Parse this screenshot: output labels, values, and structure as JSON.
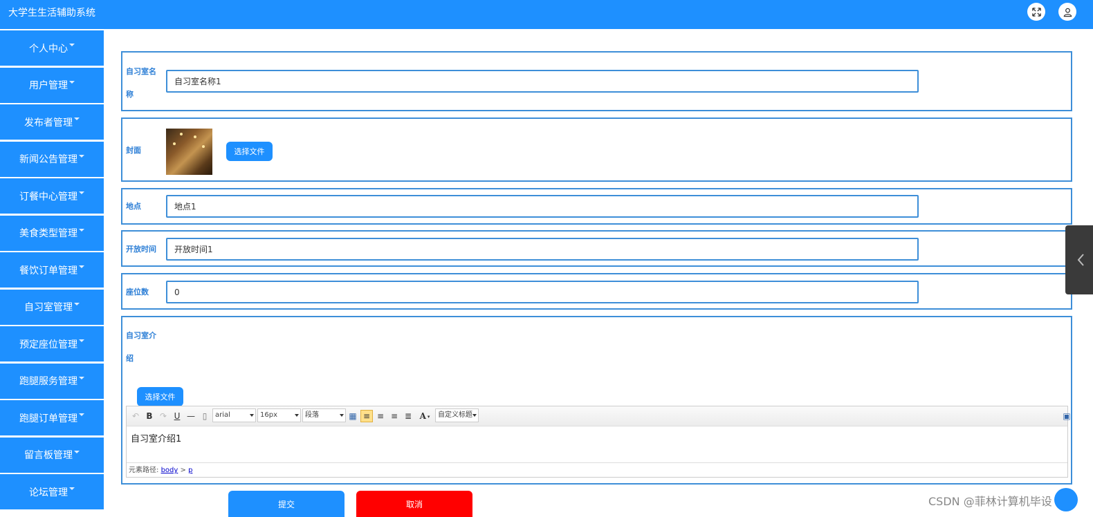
{
  "app": {
    "title": "大学生生活辅助系统"
  },
  "header": {
    "icons": [
      "fullscreen-icon",
      "user-icon"
    ]
  },
  "sidebar": {
    "items": [
      {
        "label": "个人中心"
      },
      {
        "label": "用户管理"
      },
      {
        "label": "发布者管理"
      },
      {
        "label": "新闻公告管理"
      },
      {
        "label": "订餐中心管理"
      },
      {
        "label": "美食类型管理"
      },
      {
        "label": "餐饮订单管理"
      },
      {
        "label": "自习室管理"
      },
      {
        "label": "预定座位管理"
      },
      {
        "label": "跑腿服务管理"
      },
      {
        "label": "跑腿订单管理"
      },
      {
        "label": "留言板管理"
      },
      {
        "label": "论坛管理"
      }
    ]
  },
  "form": {
    "name": {
      "label": "自习室名称",
      "value": "自习室名称1"
    },
    "cover": {
      "label": "封面",
      "button": "选择文件"
    },
    "location": {
      "label": "地点",
      "value": "地点1"
    },
    "open_time": {
      "label": "开放时间",
      "value": "开放时间1"
    },
    "seats": {
      "label": "座位数",
      "value": "0"
    },
    "intro": {
      "label": "自习室介绍",
      "button": "选择文件",
      "toolbar": {
        "font_family": "arial",
        "font_size": "16px",
        "paragraph": "段落",
        "custom_title": "自定义标题"
      },
      "content": "自习室介绍1",
      "path": {
        "prefix": "元素路径:",
        "body": "body",
        "sep": ">",
        "p": "p"
      }
    },
    "submit": "提交",
    "cancel": "取消"
  },
  "watermark": "CSDN @菲林计算机毕设",
  "colors": {
    "primary": "#1e90ff",
    "border": "#3d8ed8",
    "cancel": "#ff0000"
  }
}
